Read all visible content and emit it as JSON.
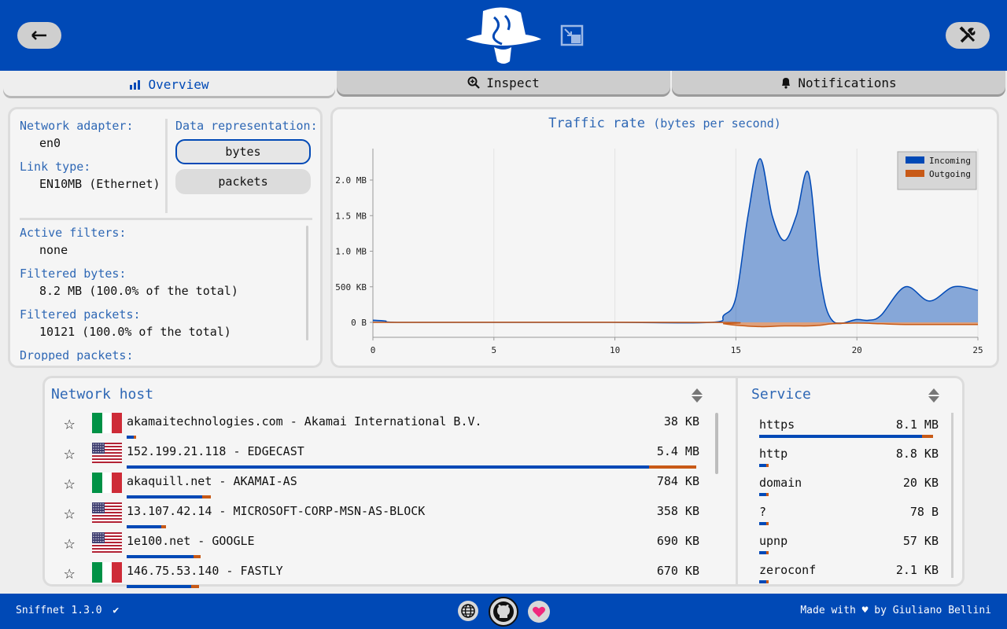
{
  "header": {
    "back_icon": "arrow-left-icon",
    "settings_icon": "wrench-icon",
    "logo": "sniffnet-logo",
    "pip_icon": "picture-in-picture-icon"
  },
  "tabs": [
    {
      "label": "Overview",
      "icon": "chart-icon",
      "active": true
    },
    {
      "label": "Inspect",
      "icon": "magnifier-icon",
      "active": false
    },
    {
      "label": "Notifications",
      "icon": "bell-icon",
      "active": false
    }
  ],
  "info": {
    "adapter_label": "Network adapter:",
    "adapter_value": "en0",
    "link_label": "Link type:",
    "link_value": "EN10MB (Ethernet)",
    "data_rep_label": "Data representation:",
    "rep_options": [
      "bytes",
      "packets"
    ],
    "rep_selected": "bytes",
    "filters_label": "Active filters:",
    "filters_value": "none",
    "fbytes_label": "Filtered bytes:",
    "fbytes_value": "8.2 MB (100.0% of the total)",
    "fpackets_label": "Filtered packets:",
    "fpackets_value": "10121 (100.0% of the total)",
    "dropped_label": "Dropped packets:"
  },
  "chart_data": {
    "type": "area",
    "title": "Traffic rate",
    "subtitle": "(bytes per second)",
    "x_ticks": [
      "0",
      "5",
      "10",
      "15",
      "20",
      "25"
    ],
    "y_ticks": [
      "0 B",
      "500 KB",
      "1.0 MB",
      "1.5 MB",
      "2.0 MB"
    ],
    "xlim": [
      0,
      25
    ],
    "ylim": [
      -0.25,
      2.45
    ],
    "legend_position": "top-right",
    "series": [
      {
        "name": "Incoming",
        "color": "#0049b6",
        "x": [
          0,
          0.5,
          1,
          5,
          10,
          14,
          14.5,
          15,
          15.5,
          16,
          16.5,
          17,
          17.5,
          18,
          18.5,
          19,
          20,
          20.5,
          21,
          22,
          23,
          24,
          25
        ],
        "y": [
          0.03,
          0.02,
          0,
          0,
          0,
          0,
          0.1,
          0.35,
          1.5,
          2.3,
          1.5,
          1.15,
          1.5,
          2.1,
          0.6,
          0.02,
          0.04,
          0.03,
          0.1,
          0.5,
          0.3,
          0.5,
          0.45
        ]
      },
      {
        "name": "Outgoing",
        "color": "#c85a17",
        "x": [
          0,
          14,
          14.5,
          15,
          16,
          17,
          18,
          18.5,
          19,
          20,
          21,
          22,
          25
        ],
        "y": [
          0,
          0,
          -0.02,
          -0.04,
          -0.06,
          -0.05,
          -0.05,
          -0.04,
          -0.02,
          -0.01,
          -0.02,
          -0.03,
          -0.03
        ]
      }
    ]
  },
  "hosts": {
    "title": "Network host",
    "rows": [
      {
        "host": "akamaitechnologies.com - Akamai International B.V.",
        "value": "38 KB",
        "flag": "italy-flag",
        "fraction": 0.007
      },
      {
        "host": "152.199.21.118 - EDGECAST",
        "value": "5.4 MB",
        "flag": "us-flag",
        "fraction": 1.0
      },
      {
        "host": "akaquill.net - AKAMAI-AS",
        "value": "784 KB",
        "flag": "italy-flag",
        "fraction": 0.145
      },
      {
        "host": "13.107.42.14 - MICROSOFT-CORP-MSN-AS-BLOCK",
        "value": "358 KB",
        "flag": "us-flag",
        "fraction": 0.066
      },
      {
        "host": "1e100.net - GOOGLE",
        "value": "690 KB",
        "flag": "us-flag",
        "fraction": 0.128
      },
      {
        "host": "146.75.53.140 - FASTLY",
        "value": "670 KB",
        "flag": "italy-flag",
        "fraction": 0.124
      }
    ]
  },
  "services": {
    "title": "Service",
    "rows": [
      {
        "name": "https",
        "value": "8.1 MB",
        "fraction": 1.0
      },
      {
        "name": "http",
        "value": "8.8 KB",
        "fraction": 0.01
      },
      {
        "name": "domain",
        "value": "20 KB",
        "fraction": 0.01
      },
      {
        "name": "?",
        "value": "78 B",
        "fraction": 0.005
      },
      {
        "name": "upnp",
        "value": "57 KB",
        "fraction": 0.01
      },
      {
        "name": "zeroconf",
        "value": "2.1 KB",
        "fraction": 0.01
      }
    ]
  },
  "footer": {
    "version": "Sniffnet 1.3.0",
    "made_with_prefix": "Made with",
    "made_with_suffix": "by Giuliano Bellini",
    "icons": [
      "globe-icon",
      "github-icon",
      "heart-icon"
    ]
  },
  "colors": {
    "primary": "#0049b6",
    "outgoing": "#c85a17",
    "label": "#2f68b5"
  }
}
